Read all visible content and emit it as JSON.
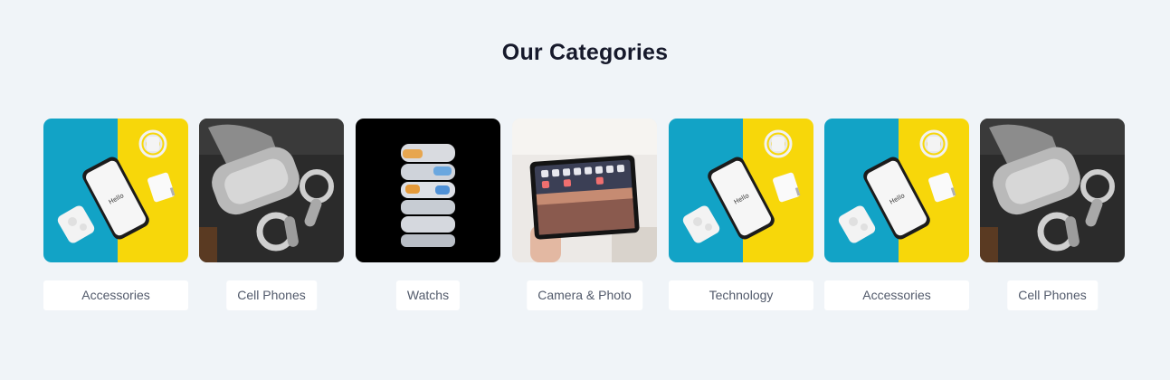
{
  "section": {
    "title": "Our Categories"
  },
  "categories": [
    {
      "label": "Accessories",
      "image": "phone-accessories-photo"
    },
    {
      "label": "Cell Phones",
      "image": "vr-headset-photo"
    },
    {
      "label": "Watchs",
      "image": "airpods-cases-photo"
    },
    {
      "label": "Camera & Photo",
      "image": "tablet-in-hand-photo"
    },
    {
      "label": "Technology",
      "image": "phone-accessories-photo"
    },
    {
      "label": "Accessories",
      "image": "phone-accessories-photo"
    },
    {
      "label": "Cell Phones",
      "image": "vr-headset-photo"
    }
  ],
  "colors": {
    "background": "#f0f4f8",
    "title": "#16192b",
    "label_text": "#525a6b",
    "label_bg": "#ffffff",
    "photo_blue": "#12a3c6",
    "photo_yellow": "#f7d70a"
  }
}
